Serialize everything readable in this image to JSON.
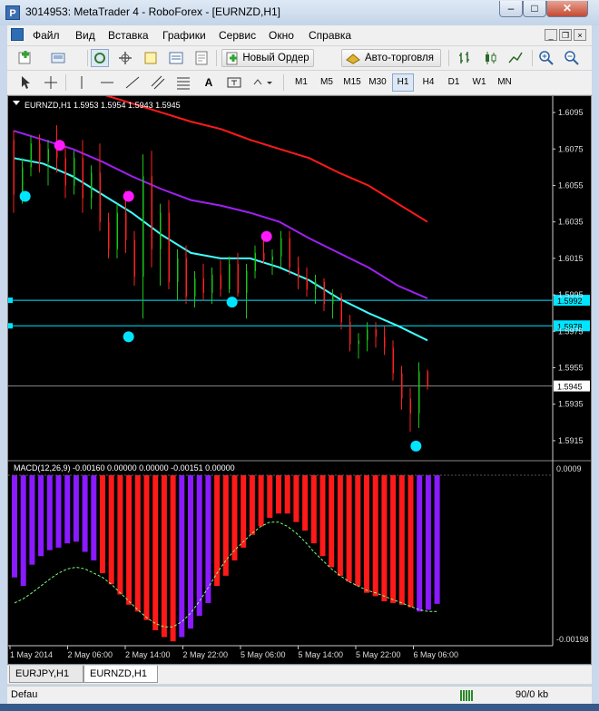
{
  "window": {
    "title": "3014953: MetaTrader 4 - RoboForex - [EURNZD,H1]",
    "app_icon_letter": "P",
    "minimize": "–",
    "maximize": "□",
    "close": "✕"
  },
  "menu": {
    "items": [
      "Файл",
      "Вид",
      "Вставка",
      "Графики",
      "Сервис",
      "Окно",
      "Справка"
    ]
  },
  "toolbar1": {
    "new_order_label": "Новый Ордер",
    "autotrading_label": "Авто-торговля"
  },
  "toolbar2": {
    "drawing_A": "A",
    "timeframes": [
      "M1",
      "M5",
      "M15",
      "M30",
      "H1",
      "H4",
      "D1",
      "W1",
      "MN"
    ],
    "selected_timeframe": "H1"
  },
  "chart_data": {
    "type": "candlestick",
    "symbol_header": "EURNZD,H1  1.5953 1.5954 1.5943 1.5945",
    "price_axis_labels": [
      "1.6095",
      "1.6075",
      "1.6055",
      "1.6035",
      "1.6015",
      "1.5995",
      "1.5975",
      "1.5955",
      "1.5935",
      "1.5915"
    ],
    "price_range": [
      1.5905,
      1.6102
    ],
    "horizontal_lines": [
      {
        "price": 1.5992,
        "label": "1.5992",
        "color": "#00e5ff"
      },
      {
        "price": 1.5978,
        "label": "1.5978",
        "color": "#00e5ff"
      }
    ],
    "current_price": {
      "value": 1.5945,
      "label": "1.5945"
    },
    "time_axis_labels": [
      "1 May 2014",
      "2 May 06:00",
      "2 May 14:00",
      "2 May 22:00",
      "5 May 06:00",
      "5 May 14:00",
      "5 May 22:00",
      "6 May 06:00"
    ],
    "candles": [
      [
        1.608,
        1.6085,
        1.604,
        1.605
      ],
      [
        1.605,
        1.607,
        1.6045,
        1.6065
      ],
      [
        1.6065,
        1.6082,
        1.606,
        1.6078
      ],
      [
        1.6078,
        1.6083,
        1.6062,
        1.6068
      ],
      [
        1.6068,
        1.608,
        1.6055,
        1.6075
      ],
      [
        1.6075,
        1.6088,
        1.6062,
        1.607
      ],
      [
        1.607,
        1.6076,
        1.6048,
        1.6055
      ],
      [
        1.6055,
        1.6074,
        1.605,
        1.607
      ],
      [
        1.607,
        1.608,
        1.604,
        1.6048
      ],
      [
        1.6048,
        1.6066,
        1.6042,
        1.6062
      ],
      [
        1.6062,
        1.6078,
        1.603,
        1.6035
      ],
      [
        1.6035,
        1.604,
        1.6015,
        1.602
      ],
      [
        1.602,
        1.6045,
        1.6015,
        1.604
      ],
      [
        1.604,
        1.6052,
        1.6018,
        1.6025
      ],
      [
        1.6025,
        1.603,
        1.6,
        1.6005
      ],
      [
        1.6005,
        1.6072,
        1.5982,
        1.606
      ],
      [
        1.606,
        1.6074,
        1.601,
        1.602
      ],
      [
        1.602,
        1.6045,
        1.6,
        1.604
      ],
      [
        1.604,
        1.6047,
        1.5998,
        1.6002
      ],
      [
        1.6002,
        1.602,
        1.5992,
        1.6015
      ],
      [
        1.6015,
        1.6022,
        1.599,
        1.5994
      ],
      [
        1.5994,
        1.6008,
        1.5988,
        1.6004
      ],
      [
        1.6004,
        1.6012,
        1.5992,
        1.5996
      ],
      [
        1.5996,
        1.601,
        1.599,
        1.6006
      ],
      [
        1.6006,
        1.6014,
        1.5994,
        1.5998
      ],
      [
        1.5998,
        1.6016,
        1.5996,
        1.6012
      ],
      [
        1.6012,
        1.6018,
        1.5994,
        1.5996
      ],
      [
        1.5996,
        1.6012,
        1.5982,
        1.6008
      ],
      [
        1.6008,
        1.6022,
        1.6004,
        1.6018
      ],
      [
        1.6018,
        1.6026,
        1.6012,
        1.6014
      ],
      [
        1.6014,
        1.602,
        1.6006,
        1.6016
      ],
      [
        1.6016,
        1.603,
        1.601,
        1.6026
      ],
      [
        1.6026,
        1.603,
        1.6006,
        1.601
      ],
      [
        1.601,
        1.6016,
        1.5998,
        1.6004
      ],
      [
        1.6004,
        1.601,
        1.5994,
        1.5998
      ],
      [
        1.5998,
        1.6006,
        1.599,
        1.6002
      ],
      [
        1.6002,
        1.6004,
        1.5986,
        1.599
      ],
      [
        1.599,
        1.5998,
        1.5982,
        1.5994
      ],
      [
        1.5994,
        1.5996,
        1.5976,
        1.598
      ],
      [
        1.598,
        1.5984,
        1.5964,
        1.5968
      ],
      [
        1.5968,
        1.5974,
        1.596,
        1.597
      ],
      [
        1.597,
        1.598,
        1.5964,
        1.5976
      ],
      [
        1.5976,
        1.598,
        1.5966,
        1.5972
      ],
      [
        1.5972,
        1.5978,
        1.5962,
        1.5966
      ],
      [
        1.5966,
        1.597,
        1.5948,
        1.5952
      ],
      [
        1.5952,
        1.5956,
        1.5932,
        1.5938
      ],
      [
        1.5938,
        1.5944,
        1.592,
        1.593
      ],
      [
        1.593,
        1.5958,
        1.5922,
        1.5953
      ],
      [
        1.5953,
        1.5954,
        1.5943,
        1.5945
      ]
    ],
    "series": [
      {
        "name": "",
        "color": "#ff1a1a",
        "values": [
          1.612,
          1.6115,
          1.611,
          1.6105,
          1.61,
          1.6095,
          1.609,
          1.6086,
          1.608,
          1.6075,
          1.607,
          1.6062,
          1.6055,
          1.6045,
          1.6035
        ]
      },
      {
        "name": "",
        "color": "#a020f0",
        "values": [
          1.6085,
          1.608,
          1.6075,
          1.6068,
          1.606,
          1.6053,
          1.6047,
          1.6044,
          1.604,
          1.6035,
          1.6026,
          1.6018,
          1.601,
          1.6,
          1.5993
        ]
      },
      {
        "name": "",
        "color": "#40ffff",
        "values": [
          1.607,
          1.6067,
          1.606,
          1.605,
          1.604,
          1.6028,
          1.6018,
          1.6015,
          1.6015,
          1.601,
          1.6003,
          1.5993,
          1.5985,
          1.5978,
          1.597
        ]
      }
    ],
    "fractal_dots": [
      {
        "index": 1,
        "price": 1.6049,
        "color": "#00e5ff"
      },
      {
        "index": 4,
        "price": 1.6077,
        "color": "#ff1aff"
      },
      {
        "index": 10,
        "price": 1.6049,
        "color": "#ff1aff"
      },
      {
        "index": 10,
        "price": 1.5972,
        "color": "#00e5ff"
      },
      {
        "index": 19,
        "price": 1.5991,
        "color": "#00e5ff"
      },
      {
        "index": 22,
        "price": 1.6027,
        "color": "#ff1aff"
      },
      {
        "index": 35,
        "price": 1.5912,
        "color": "#00e5ff"
      }
    ],
    "macd": {
      "header": "MACD(12,26,9) -0.00160 0.00000 0.00000 -0.00151 0.00000",
      "axis_labels": [
        "0.0009",
        "-0.00198"
      ],
      "range": [
        -0.00198,
        0.0
      ],
      "histogram": [
        -0.0012,
        -0.0013,
        -0.00105,
        -0.00095,
        -0.00088,
        -0.00085,
        -0.0008,
        -0.00078,
        -0.0009,
        -0.001,
        -0.00115,
        -0.00128,
        -0.0014,
        -0.00152,
        -0.0016,
        -0.0017,
        -0.00182,
        -0.0019,
        -0.00195,
        -0.0019,
        -0.0018,
        -0.00165,
        -0.0015,
        -0.0013,
        -0.00118,
        -0.001,
        -0.00085,
        -0.0007,
        -0.0006,
        -0.0005,
        -0.00045,
        -0.00045,
        -0.00055,
        -0.00065,
        -0.0008,
        -0.00095,
        -0.00108,
        -0.00118,
        -0.00125,
        -0.0013,
        -0.00138,
        -0.00142,
        -0.00148,
        -0.0015,
        -0.00152,
        -0.00155,
        -0.0016,
        -0.00158,
        -0.00151
      ],
      "colors_from_index": {
        "0": "#8a1aff",
        "10": "#ff1a1a",
        "19": "#8a1aff",
        "23": "#ff1a1a",
        "46": "#8a1aff"
      },
      "signal": [
        -0.0015,
        -0.00145,
        -0.00138,
        -0.0013,
        -0.00122,
        -0.00115,
        -0.0011,
        -0.00108,
        -0.0011,
        -0.00115,
        -0.0012,
        -0.00128,
        -0.00138,
        -0.00148,
        -0.00158,
        -0.00167,
        -0.00174,
        -0.00178,
        -0.00178,
        -0.00172,
        -0.00162,
        -0.00148,
        -0.00132,
        -0.00115,
        -0.001,
        -0.00088,
        -0.00078,
        -0.00068,
        -0.0006,
        -0.00055,
        -0.00055,
        -0.0006,
        -0.00068,
        -0.00078,
        -0.0009,
        -0.001,
        -0.0011,
        -0.00118,
        -0.00125,
        -0.0013,
        -0.00135,
        -0.00138,
        -0.00142,
        -0.00146,
        -0.0015,
        -0.00154,
        -0.00158,
        -0.0016,
        -0.0016
      ]
    }
  },
  "tabs": [
    {
      "label": "EURJPY,H1",
      "active": false
    },
    {
      "label": "EURNZD,H1",
      "active": true
    }
  ],
  "status": {
    "left": "Defau",
    "traffic": "90/0 kb"
  }
}
